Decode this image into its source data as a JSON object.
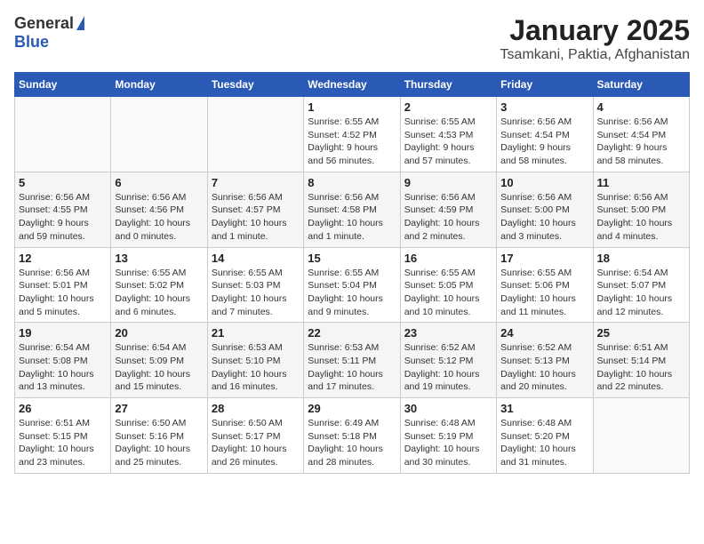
{
  "header": {
    "logo_general": "General",
    "logo_blue": "Blue",
    "month_title": "January 2025",
    "location": "Tsamkani, Paktia, Afghanistan"
  },
  "weekdays": [
    "Sunday",
    "Monday",
    "Tuesday",
    "Wednesday",
    "Thursday",
    "Friday",
    "Saturday"
  ],
  "weeks": [
    [
      {
        "day": "",
        "info": ""
      },
      {
        "day": "",
        "info": ""
      },
      {
        "day": "",
        "info": ""
      },
      {
        "day": "1",
        "info": "Sunrise: 6:55 AM\nSunset: 4:52 PM\nDaylight: 9 hours\nand 56 minutes."
      },
      {
        "day": "2",
        "info": "Sunrise: 6:55 AM\nSunset: 4:53 PM\nDaylight: 9 hours\nand 57 minutes."
      },
      {
        "day": "3",
        "info": "Sunrise: 6:56 AM\nSunset: 4:54 PM\nDaylight: 9 hours\nand 58 minutes."
      },
      {
        "day": "4",
        "info": "Sunrise: 6:56 AM\nSunset: 4:54 PM\nDaylight: 9 hours\nand 58 minutes."
      }
    ],
    [
      {
        "day": "5",
        "info": "Sunrise: 6:56 AM\nSunset: 4:55 PM\nDaylight: 9 hours\nand 59 minutes."
      },
      {
        "day": "6",
        "info": "Sunrise: 6:56 AM\nSunset: 4:56 PM\nDaylight: 10 hours\nand 0 minutes."
      },
      {
        "day": "7",
        "info": "Sunrise: 6:56 AM\nSunset: 4:57 PM\nDaylight: 10 hours\nand 1 minute."
      },
      {
        "day": "8",
        "info": "Sunrise: 6:56 AM\nSunset: 4:58 PM\nDaylight: 10 hours\nand 1 minute."
      },
      {
        "day": "9",
        "info": "Sunrise: 6:56 AM\nSunset: 4:59 PM\nDaylight: 10 hours\nand 2 minutes."
      },
      {
        "day": "10",
        "info": "Sunrise: 6:56 AM\nSunset: 5:00 PM\nDaylight: 10 hours\nand 3 minutes."
      },
      {
        "day": "11",
        "info": "Sunrise: 6:56 AM\nSunset: 5:00 PM\nDaylight: 10 hours\nand 4 minutes."
      }
    ],
    [
      {
        "day": "12",
        "info": "Sunrise: 6:56 AM\nSunset: 5:01 PM\nDaylight: 10 hours\nand 5 minutes."
      },
      {
        "day": "13",
        "info": "Sunrise: 6:55 AM\nSunset: 5:02 PM\nDaylight: 10 hours\nand 6 minutes."
      },
      {
        "day": "14",
        "info": "Sunrise: 6:55 AM\nSunset: 5:03 PM\nDaylight: 10 hours\nand 7 minutes."
      },
      {
        "day": "15",
        "info": "Sunrise: 6:55 AM\nSunset: 5:04 PM\nDaylight: 10 hours\nand 9 minutes."
      },
      {
        "day": "16",
        "info": "Sunrise: 6:55 AM\nSunset: 5:05 PM\nDaylight: 10 hours\nand 10 minutes."
      },
      {
        "day": "17",
        "info": "Sunrise: 6:55 AM\nSunset: 5:06 PM\nDaylight: 10 hours\nand 11 minutes."
      },
      {
        "day": "18",
        "info": "Sunrise: 6:54 AM\nSunset: 5:07 PM\nDaylight: 10 hours\nand 12 minutes."
      }
    ],
    [
      {
        "day": "19",
        "info": "Sunrise: 6:54 AM\nSunset: 5:08 PM\nDaylight: 10 hours\nand 13 minutes."
      },
      {
        "day": "20",
        "info": "Sunrise: 6:54 AM\nSunset: 5:09 PM\nDaylight: 10 hours\nand 15 minutes."
      },
      {
        "day": "21",
        "info": "Sunrise: 6:53 AM\nSunset: 5:10 PM\nDaylight: 10 hours\nand 16 minutes."
      },
      {
        "day": "22",
        "info": "Sunrise: 6:53 AM\nSunset: 5:11 PM\nDaylight: 10 hours\nand 17 minutes."
      },
      {
        "day": "23",
        "info": "Sunrise: 6:52 AM\nSunset: 5:12 PM\nDaylight: 10 hours\nand 19 minutes."
      },
      {
        "day": "24",
        "info": "Sunrise: 6:52 AM\nSunset: 5:13 PM\nDaylight: 10 hours\nand 20 minutes."
      },
      {
        "day": "25",
        "info": "Sunrise: 6:51 AM\nSunset: 5:14 PM\nDaylight: 10 hours\nand 22 minutes."
      }
    ],
    [
      {
        "day": "26",
        "info": "Sunrise: 6:51 AM\nSunset: 5:15 PM\nDaylight: 10 hours\nand 23 minutes."
      },
      {
        "day": "27",
        "info": "Sunrise: 6:50 AM\nSunset: 5:16 PM\nDaylight: 10 hours\nand 25 minutes."
      },
      {
        "day": "28",
        "info": "Sunrise: 6:50 AM\nSunset: 5:17 PM\nDaylight: 10 hours\nand 26 minutes."
      },
      {
        "day": "29",
        "info": "Sunrise: 6:49 AM\nSunset: 5:18 PM\nDaylight: 10 hours\nand 28 minutes."
      },
      {
        "day": "30",
        "info": "Sunrise: 6:48 AM\nSunset: 5:19 PM\nDaylight: 10 hours\nand 30 minutes."
      },
      {
        "day": "31",
        "info": "Sunrise: 6:48 AM\nSunset: 5:20 PM\nDaylight: 10 hours\nand 31 minutes."
      },
      {
        "day": "",
        "info": ""
      }
    ]
  ]
}
